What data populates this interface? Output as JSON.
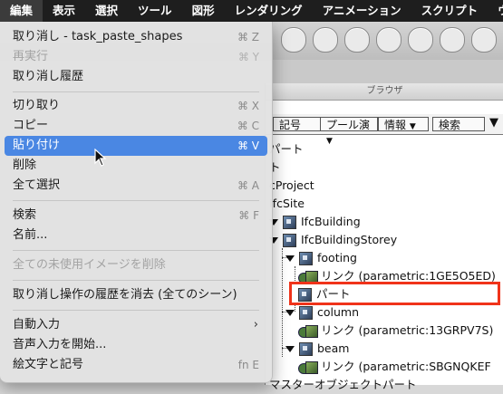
{
  "menubar": {
    "items": [
      "編集",
      "表示",
      "選択",
      "ツール",
      "図形",
      "レンダリング",
      "アニメーション",
      "スクリプト",
      "ウイ"
    ]
  },
  "edit_menu": {
    "items": [
      {
        "label": "取り消し - task_paste_shapes",
        "shortcut": "⌘ Z",
        "state": "enabled"
      },
      {
        "label": "再実行",
        "shortcut": "⌘ Y",
        "state": "disabled"
      },
      {
        "label": "取り消し履歴",
        "shortcut": "",
        "state": "enabled"
      },
      {
        "label": "切り取り",
        "shortcut": "⌘ X",
        "state": "enabled"
      },
      {
        "label": "コピー",
        "shortcut": "⌘ C",
        "state": "enabled"
      },
      {
        "label": "貼り付け",
        "shortcut": "⌘ V",
        "state": "selected"
      },
      {
        "label": "削除",
        "shortcut": "",
        "state": "enabled"
      },
      {
        "label": "全て選択",
        "shortcut": "⌘ A",
        "state": "enabled"
      },
      {
        "label": "検索",
        "shortcut": "⌘ F",
        "state": "enabled"
      },
      {
        "label": "名前...",
        "shortcut": "",
        "state": "enabled"
      },
      {
        "label": "全ての未使用イメージを削除",
        "shortcut": "",
        "state": "disabled"
      },
      {
        "label": "取り消し操作の履歴を消去 (全てのシーン)",
        "shortcut": "",
        "state": "enabled"
      },
      {
        "label": "自動入力",
        "shortcut": "",
        "state": "submenu"
      },
      {
        "label": "音声入力を開始...",
        "shortcut": "",
        "state": "enabled"
      },
      {
        "label": "絵文字と記号",
        "shortcut": "fn E",
        "state": "enabled"
      }
    ]
  },
  "browser": {
    "title": "ブラウザ",
    "tabs": [
      "記号",
      "プール演",
      "情報",
      "検索"
    ],
    "tree": [
      "パート",
      "ト",
      "cProject",
      "IfcSite",
      "IfcBuilding",
      "IfcBuildingStorey",
      "footing",
      "リンク (parametric:1GE5O5ED)",
      "パート",
      "column",
      "リンク (parametric:13GRPV7S)",
      "beam",
      "リンク (parametric:SBGNQKEF",
      "マスターオブジェクトパート"
    ]
  }
}
